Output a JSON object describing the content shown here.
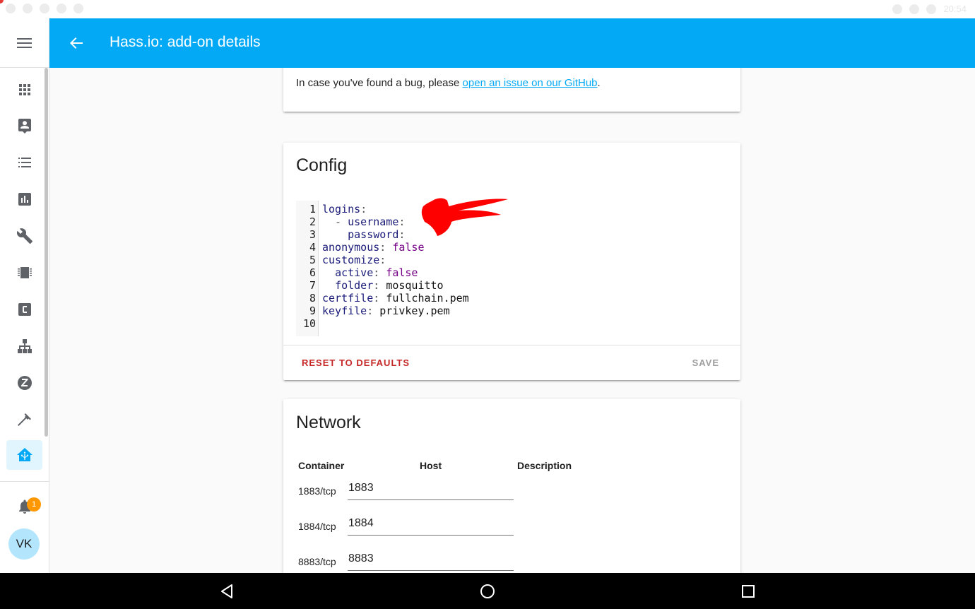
{
  "appbar": {
    "title": "Hass.io: add-on details"
  },
  "status_bar": {
    "time": "20:54"
  },
  "sidebar": {
    "items": [
      {
        "icon": "apps-icon"
      },
      {
        "icon": "account-box-icon"
      },
      {
        "icon": "format-list-icon"
      },
      {
        "icon": "chart-box-icon"
      },
      {
        "icon": "wrench-icon"
      },
      {
        "icon": "chip-icon"
      },
      {
        "icon": "c-box-icon"
      },
      {
        "icon": "sitemap-icon"
      },
      {
        "icon": "z-wave-icon"
      },
      {
        "icon": "hammer-icon"
      },
      {
        "icon": "hassio-icon",
        "active": true
      }
    ],
    "notification_count": "1",
    "user_initials": "VK",
    "accent_color": "#03a9f4"
  },
  "bug_card": {
    "text": "In case you've found a bug, please ",
    "link": "open an issue on our GitHub",
    "suffix": "."
  },
  "config_card": {
    "title": "Config",
    "lines": [
      {
        "n": "1",
        "key": "logins",
        "sep": ":",
        "val": "",
        "type": ""
      },
      {
        "n": "2",
        "indent": "  - ",
        "key": "username",
        "sep": ":",
        "val": "",
        "type": ""
      },
      {
        "n": "3",
        "indent": "    ",
        "key": "password",
        "sep": ":",
        "val": "",
        "type": ""
      },
      {
        "n": "4",
        "key": "anonymous",
        "sep": ": ",
        "val": "false",
        "type": "b"
      },
      {
        "n": "5",
        "key": "customize",
        "sep": ":",
        "val": "",
        "type": ""
      },
      {
        "n": "6",
        "indent": "  ",
        "key": "active",
        "sep": ": ",
        "val": "false",
        "type": "b"
      },
      {
        "n": "7",
        "indent": "  ",
        "key": "folder",
        "sep": ": ",
        "val": "mosquitto",
        "type": "v"
      },
      {
        "n": "8",
        "key": "certfile",
        "sep": ": ",
        "val": "fullchain.pem",
        "type": "v"
      },
      {
        "n": "9",
        "key": "keyfile",
        "sep": ": ",
        "val": "privkey.pem",
        "type": "v"
      },
      {
        "n": "10",
        "key": "",
        "sep": "",
        "val": "",
        "type": ""
      }
    ],
    "reset_label": "RESET TO DEFAULTS",
    "save_label": "SAVE",
    "reset_color": "#c62828"
  },
  "network_card": {
    "title": "Network",
    "headers": {
      "container": "Container",
      "host": "Host",
      "description": "Description"
    },
    "rows": [
      {
        "container": "1883/tcp",
        "host": "1883"
      },
      {
        "container": "1884/tcp",
        "host": "1884"
      },
      {
        "container": "8883/tcp",
        "host": "8883"
      }
    ]
  },
  "nav_bar": {
    "icons": [
      "back-triangle-icon",
      "home-circle-icon",
      "recents-square-icon"
    ]
  }
}
